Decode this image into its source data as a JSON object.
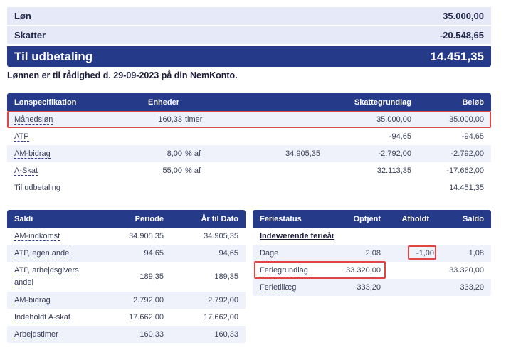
{
  "summary": {
    "loen_label": "Løn",
    "loen_value": "35.000,00",
    "skatter_label": "Skatter",
    "skatter_value": "-20.548,65",
    "payout_label": "Til udbetaling",
    "payout_value": "14.451,35",
    "note": "Lønnen er til rådighed d. 29-09-2023 på din NemKonto."
  },
  "spec": {
    "headers": {
      "name": "Lønspecifikation",
      "units": "Enheder",
      "tax_base": "Skattegrundlag",
      "amount": "Beløb"
    },
    "rows": [
      {
        "name": "Månedsløn",
        "units": "160,33",
        "unit_type": "timer",
        "basis": "",
        "tax_base": "35.000,00",
        "amount": "35.000,00"
      },
      {
        "name": "ATP",
        "units": "",
        "unit_type": "",
        "basis": "",
        "tax_base": "-94,65",
        "amount": "-94,65"
      },
      {
        "name": "AM-bidrag",
        "units": "8,00",
        "unit_type": "% af",
        "basis": "34.905,35",
        "tax_base": "-2.792,00",
        "amount": "-2.792,00"
      },
      {
        "name": "A-Skat",
        "units": "55,00",
        "unit_type": "% af",
        "basis": "",
        "tax_base": "32.113,35",
        "amount": "-17.662,00"
      },
      {
        "name": "Til udbetaling",
        "units": "",
        "unit_type": "",
        "basis": "",
        "tax_base": "",
        "amount": "14.451,35"
      }
    ]
  },
  "saldi": {
    "headers": {
      "name": "Saldi",
      "period": "Periode",
      "ytd": "År til Dato"
    },
    "rows": [
      {
        "name": "AM-indkomst",
        "period": "34.905,35",
        "ytd": "34.905,35"
      },
      {
        "name": "ATP, egen andel",
        "period": "94,65",
        "ytd": "94,65"
      },
      {
        "name_line1": "ATP, arbejdsgivers",
        "name_line2": "andel",
        "period": "189,35",
        "ytd": "189,35"
      },
      {
        "name": "AM-bidrag",
        "period": "2.792,00",
        "ytd": "2.792,00"
      },
      {
        "name": "Indeholdt A-skat",
        "period": "17.662,00",
        "ytd": "17.662,00"
      },
      {
        "name": "Arbejdstimer",
        "period": "160,33",
        "ytd": "160,33"
      }
    ]
  },
  "ferie": {
    "headers": {
      "name": "Feriestatus",
      "earned": "Optjent",
      "taken": "Afholdt",
      "balance": "Saldo"
    },
    "section": "Indeværende ferieår",
    "rows": [
      {
        "name": "Dage",
        "earned": "2,08",
        "taken": "-1,00",
        "balance": "1,08"
      },
      {
        "name": "Feriegrundlag",
        "earned": "33.320,00",
        "taken": "",
        "balance": "33.320,00"
      },
      {
        "name": "Ferietillæg",
        "earned": "333,20",
        "taken": "",
        "balance": "333,20"
      }
    ]
  }
}
